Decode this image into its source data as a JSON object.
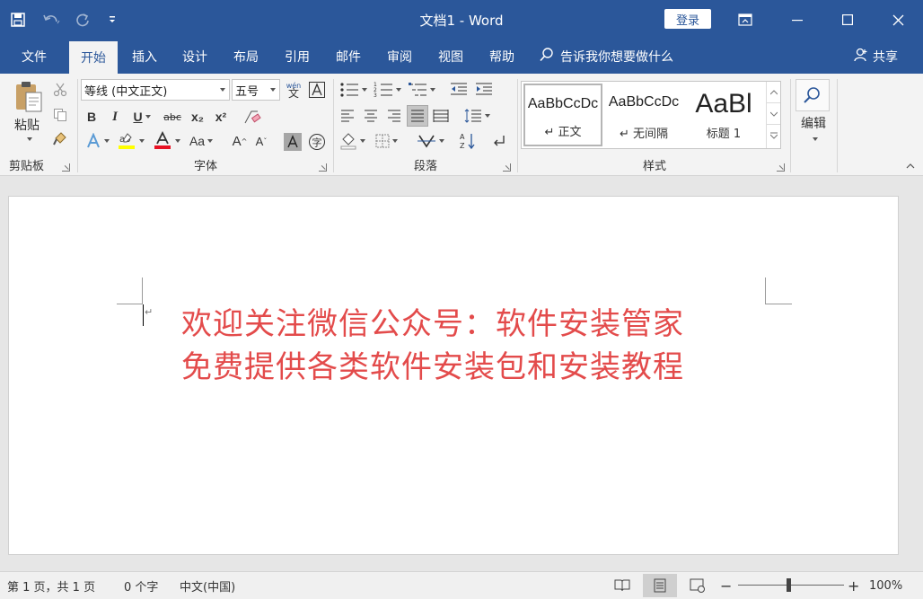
{
  "titlebar": {
    "title": "文档1  -  Word",
    "login_label": "登录",
    "save_icon": "save-icon",
    "undo_icon": "undo-icon",
    "redo_icon": "redo-icon",
    "customize_icon": "customize-qat-icon",
    "bg_color": "#2b579a"
  },
  "tabs": [
    {
      "label": "文件"
    },
    {
      "label": "开始",
      "active": true
    },
    {
      "label": "插入"
    },
    {
      "label": "设计"
    },
    {
      "label": "布局"
    },
    {
      "label": "引用"
    },
    {
      "label": "邮件"
    },
    {
      "label": "审阅"
    },
    {
      "label": "视图"
    },
    {
      "label": "帮助"
    }
  ],
  "tellme": {
    "label": "告诉我你想要做什么",
    "icon": "lightbulb-search-icon"
  },
  "share": {
    "label": "共享",
    "icon": "person-icon"
  },
  "ribbon": {
    "clipboard": {
      "label": "剪贴板",
      "paste_label": "粘贴"
    },
    "font": {
      "label": "字体",
      "font_name": "等线 (中文正文)",
      "font_size": "五号",
      "phonetic": "wén",
      "phonetic_char": "文",
      "bold": "B",
      "italic": "I",
      "underline": "U",
      "strike": "abc",
      "subscript": "x₂",
      "superscript": "x²",
      "change_case": "Aa",
      "grow": "A",
      "shrink": "A",
      "enclose": "字",
      "highlight_color": "#ffff00",
      "font_color": "#e81123"
    },
    "paragraph": {
      "label": "段落"
    },
    "styles": {
      "label": "样式",
      "items": [
        {
          "sample": "AaBbCcDc",
          "name": "↵ 正文"
        },
        {
          "sample": "AaBbCcDc",
          "name": "↵ 无间隔"
        },
        {
          "sample": "AaBl",
          "name": "标题 1"
        }
      ]
    },
    "editing": {
      "label": "编辑"
    }
  },
  "document": {
    "lines": [
      "欢迎关注微信公众号：软件安装管家",
      "免费提供各类软件安装包和安装教程"
    ],
    "text_color": "#e34b4b",
    "para_mark": "↵"
  },
  "status": {
    "page": "第 1 页，共 1 页",
    "words": "0 个字",
    "language": "中文(中国)",
    "zoom": "100%",
    "zoom_level_percent": 100
  }
}
